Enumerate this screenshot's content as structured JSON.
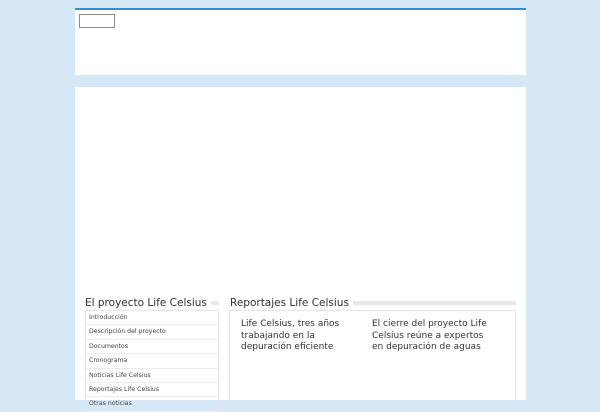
{
  "sidebar": {
    "title": "El proyecto Life Celsius",
    "items": [
      "Introducción",
      "Descripción del proyecto",
      "Documentos",
      "Cronograma",
      "Noticias Life Celsius",
      "Reportajes Life Celsius",
      "Otras noticias"
    ]
  },
  "reports": {
    "title": "Reportajes Life Celsius",
    "articles": [
      {
        "title": "Life Celsius, tres años trabajando en la depuración eficiente"
      },
      {
        "title": "El cierre del proyecto Life Celsius reúne a expertos en depuración de aguas"
      }
    ]
  },
  "colors": {
    "page_background": "#d6e8f5",
    "accent": "#2f8fd6",
    "panel": "#ffffff"
  }
}
